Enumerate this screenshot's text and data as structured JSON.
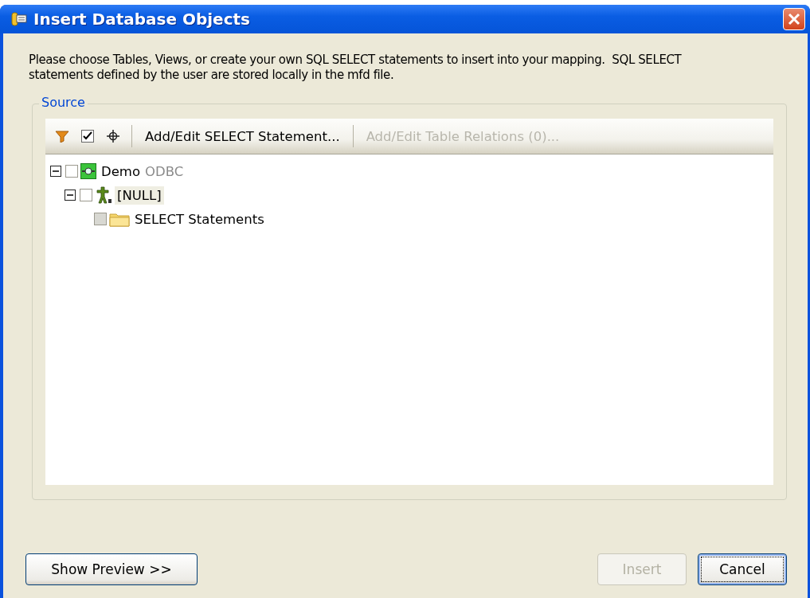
{
  "window": {
    "title": "Insert Database Objects"
  },
  "description": "Please choose Tables, Views, or create your own SQL SELECT statements to insert into your mapping.  SQL SELECT statements defined by the user are stored locally in the mfd file.",
  "source": {
    "label": "Source",
    "toolbar": [
      {
        "kind": "filter"
      },
      {
        "kind": "check"
      },
      {
        "kind": "crosshair"
      },
      {
        "kind": "separator"
      },
      {
        "kind": "button",
        "label": "Add/Edit SELECT Statement...",
        "disabled": false
      },
      {
        "kind": "separator"
      },
      {
        "kind": "button",
        "label": "Add/Edit Table Relations (0)...",
        "disabled": true
      }
    ],
    "tree": [
      {
        "kind": "datasource",
        "label": "Demo",
        "detail": "ODBC",
        "expanded": true,
        "checked": false,
        "disabled": false,
        "selected": false,
        "children": [
          {
            "kind": "schema",
            "label": "[NULL]",
            "expanded": true,
            "checked": false,
            "disabled": false,
            "selected": true,
            "children": [
              {
                "kind": "folder",
                "label": "SELECT Statements",
                "checked": false,
                "disabled": true,
                "selected": false
              }
            ]
          }
        ]
      }
    ]
  },
  "buttons": [
    {
      "label": "Show Preview >>",
      "disabled": false,
      "default": false
    },
    {
      "label": "Insert",
      "disabled": true,
      "default": false
    },
    {
      "label": "Cancel",
      "disabled": false,
      "default": true
    }
  ]
}
